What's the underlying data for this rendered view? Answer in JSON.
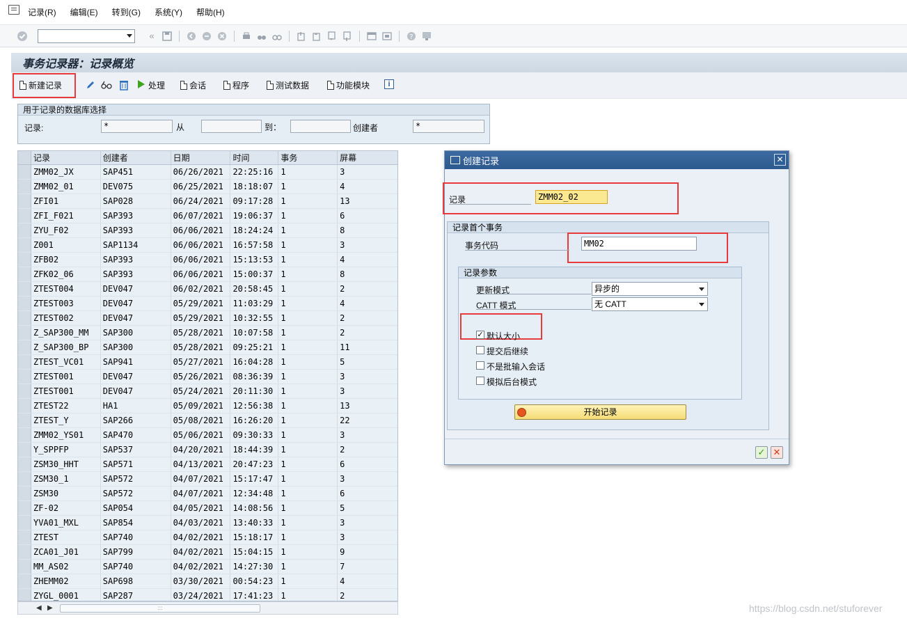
{
  "menubar": {
    "icon": "transaction-icon",
    "items": [
      "记录(R)",
      "编辑(E)",
      "转到(G)",
      "系统(Y)",
      "帮助(H)"
    ]
  },
  "systoolbar": {
    "command_value": ""
  },
  "title": "事务记录器：记录概览",
  "apptoolbar": {
    "new_record": "新建记录",
    "process": "处理",
    "session": "会话",
    "program": "程序",
    "test_data": "测试数据",
    "function_module": "功能模块",
    "info": "i"
  },
  "selection": {
    "title": "用于记录的数据库选择",
    "record_label": "记录:",
    "record_value": "*",
    "from_label": "从",
    "from_value": "",
    "to_label": "到：",
    "to_value": "",
    "creator_label": "创建者",
    "creator_value": "*"
  },
  "table": {
    "headers": [
      "记录",
      "创建者",
      "日期",
      "时间",
      "事务",
      "屏幕"
    ],
    "rows": [
      [
        "ZMM02_JX",
        "SAP451",
        "06/26/2021",
        "22:25:16",
        "1",
        "3"
      ],
      [
        "ZMM02_01",
        "DEV075",
        "06/25/2021",
        "18:18:07",
        "1",
        "4"
      ],
      [
        "ZFI01",
        "SAP028",
        "06/24/2021",
        "09:17:28",
        "1",
        "13"
      ],
      [
        "ZFI_F021",
        "SAP393",
        "06/07/2021",
        "19:06:37",
        "1",
        "6"
      ],
      [
        "ZYU_F02",
        "SAP393",
        "06/06/2021",
        "18:24:24",
        "1",
        "8"
      ],
      [
        "Z001",
        "SAP1134",
        "06/06/2021",
        "16:57:58",
        "1",
        "3"
      ],
      [
        "ZFB02",
        "SAP393",
        "06/06/2021",
        "15:13:53",
        "1",
        "4"
      ],
      [
        "ZFK02_06",
        "SAP393",
        "06/06/2021",
        "15:00:37",
        "1",
        "8"
      ],
      [
        "ZTEST004",
        "DEV047",
        "06/02/2021",
        "20:58:45",
        "1",
        "2"
      ],
      [
        "ZTEST003",
        "DEV047",
        "05/29/2021",
        "11:03:29",
        "1",
        "4"
      ],
      [
        "ZTEST002",
        "DEV047",
        "05/29/2021",
        "10:32:55",
        "1",
        "2"
      ],
      [
        "Z_SAP300_MM",
        "SAP300",
        "05/28/2021",
        "10:07:58",
        "1",
        "2"
      ],
      [
        "Z_SAP300_BP",
        "SAP300",
        "05/28/2021",
        "09:25:21",
        "1",
        "11"
      ],
      [
        "ZTEST_VC01",
        "SAP941",
        "05/27/2021",
        "16:04:28",
        "1",
        "5"
      ],
      [
        "ZTEST001",
        "DEV047",
        "05/26/2021",
        "08:36:39",
        "1",
        "3"
      ],
      [
        "ZTEST001",
        "DEV047",
        "05/24/2021",
        "20:11:30",
        "1",
        "3"
      ],
      [
        "ZTEST22",
        "HA1",
        "05/09/2021",
        "12:56:38",
        "1",
        "13"
      ],
      [
        "ZTEST_Y",
        "SAP266",
        "05/08/2021",
        "16:26:20",
        "1",
        "22"
      ],
      [
        "ZMM02_YS01",
        "SAP470",
        "05/06/2021",
        "09:30:33",
        "1",
        "3"
      ],
      [
        "Y_SPPFP",
        "SAP537",
        "04/20/2021",
        "18:44:39",
        "1",
        "2"
      ],
      [
        "ZSM30_HHT",
        "SAP571",
        "04/13/2021",
        "20:47:23",
        "1",
        "6"
      ],
      [
        "ZSM30_1",
        "SAP572",
        "04/07/2021",
        "15:17:47",
        "1",
        "3"
      ],
      [
        "ZSM30",
        "SAP572",
        "04/07/2021",
        "12:34:48",
        "1",
        "6"
      ],
      [
        "ZF-02",
        "SAP054",
        "04/05/2021",
        "14:08:56",
        "1",
        "5"
      ],
      [
        "YVA01_MXL",
        "SAP854",
        "04/03/2021",
        "13:40:33",
        "1",
        "3"
      ],
      [
        "ZTEST",
        "SAP740",
        "04/02/2021",
        "15:18:17",
        "1",
        "3"
      ],
      [
        "ZCA01_J01",
        "SAP799",
        "04/02/2021",
        "15:04:15",
        "1",
        "9"
      ],
      [
        "MM_AS02",
        "SAP740",
        "04/02/2021",
        "14:27:30",
        "1",
        "7"
      ],
      [
        "ZHEMM02",
        "SAP698",
        "03/30/2021",
        "00:54:23",
        "1",
        "4"
      ],
      [
        "ZYGL_0001",
        "SAP287",
        "03/24/2021",
        "17:41:23",
        "1",
        "2"
      ]
    ]
  },
  "dialog": {
    "title": "创建记录",
    "record_label": "记录",
    "record_value": "ZMM02_02",
    "first_tx_title": "记录首个事务",
    "tcode_label": "事务代码",
    "tcode_value": "MM02",
    "params_title": "记录参数",
    "update_mode_label": "更新模式",
    "update_mode_value": "异步的",
    "catt_mode_label": "CATT 模式",
    "catt_mode_value": "无 CATT",
    "default_size_label": "默认大小",
    "default_size_checked": true,
    "continue_after_commit_label": "提交后继续",
    "not_batch_input_label": "不是批输入会话",
    "simulate_bg_label": "模拟后台模式",
    "start_button": "开始记录"
  },
  "watermark": "https://blog.csdn.net/stuforever",
  "colors": {
    "highlight_red": "#e83a3a",
    "dialog_title_bg": "#2c5a8e",
    "start_button_bg": "#f5dc76"
  }
}
